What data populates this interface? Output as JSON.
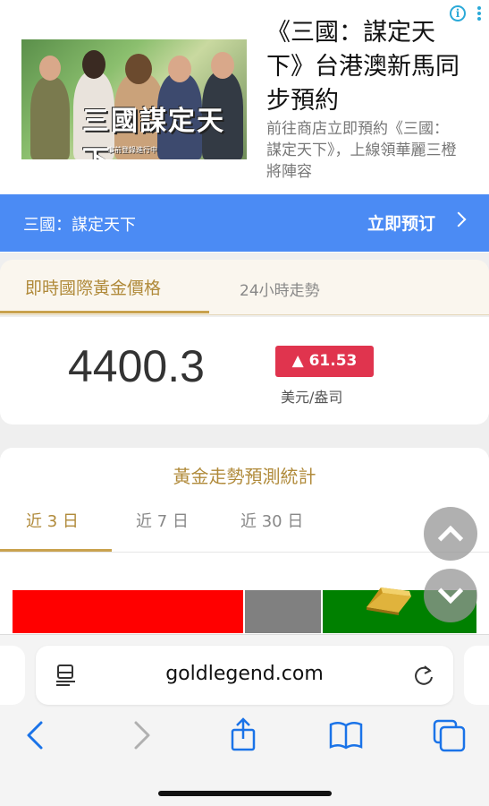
{
  "ad": {
    "headline": "《三國：謀定天下》台港澳新馬同步預約",
    "description": "前往商店立即預約《三國：謀定天下》，上線領華麗三橙將陣容",
    "image_logo": "三國謀定天下",
    "image_sub": "事前登錄進行中",
    "bar_title": "三國：謀定天下",
    "cta": "立即预订"
  },
  "gold": {
    "tabs": [
      "即時國際黃金價格",
      "24小時走勢"
    ],
    "price": "4400.3",
    "change": "▲ 61.53",
    "unit": "美元/盎司",
    "change_color": "#e0344e"
  },
  "forecast": {
    "title": "黃金走勢預測統計",
    "tabs": [
      "近 3 日",
      "近 7 日",
      "近 30 日"
    ],
    "segments": [
      {
        "color": "#ff0000",
        "fraction": 0.497
      },
      {
        "color": "#808080",
        "fraction": 0.167
      },
      {
        "color": "#008000",
        "fraction": 0.336
      }
    ]
  },
  "browser": {
    "url": "goldlegend.com",
    "icons": [
      "back-icon",
      "forward-icon",
      "share-icon",
      "bookmarks-icon",
      "tabs-icon"
    ]
  },
  "floating": [
    "scroll-up-icon",
    "scroll-down-icon"
  ]
}
